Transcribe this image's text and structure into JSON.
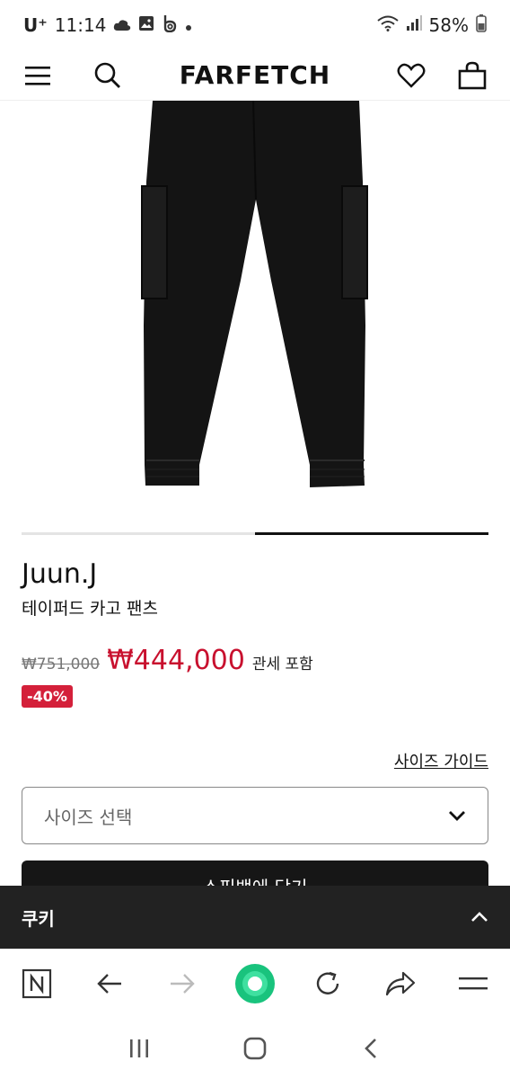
{
  "status": {
    "carrier": "U⁺",
    "time": "11:14",
    "battery": "58%"
  },
  "header": {
    "logo": "FARFETCH"
  },
  "product": {
    "brand": "Juun.J",
    "name": "테이퍼드 카고 팬츠",
    "original_price": "₩751,000",
    "sale_price": "₩444,000",
    "tax_note": "관세 포함",
    "discount_badge": "-40%",
    "carousel": {
      "current_slide": 2,
      "total_slides": 2
    }
  },
  "size": {
    "guide_label": "사이즈 가이드",
    "select_placeholder": "사이즈 선택"
  },
  "cart": {
    "button_label": "쇼핑백에 담기"
  },
  "cookie": {
    "label": "쿠키"
  },
  "colors": {
    "sale_red": "#c8102e",
    "badge_red": "#d4203a",
    "dark": "#161616",
    "browser_green": "#19c37d"
  },
  "icons": {
    "menu": "menu-icon",
    "search": "search-icon",
    "wishlist": "heart-icon",
    "bag": "bag-icon",
    "dropdown": "chevron-down-icon",
    "cookie_toggle": "chevron-up-icon"
  }
}
